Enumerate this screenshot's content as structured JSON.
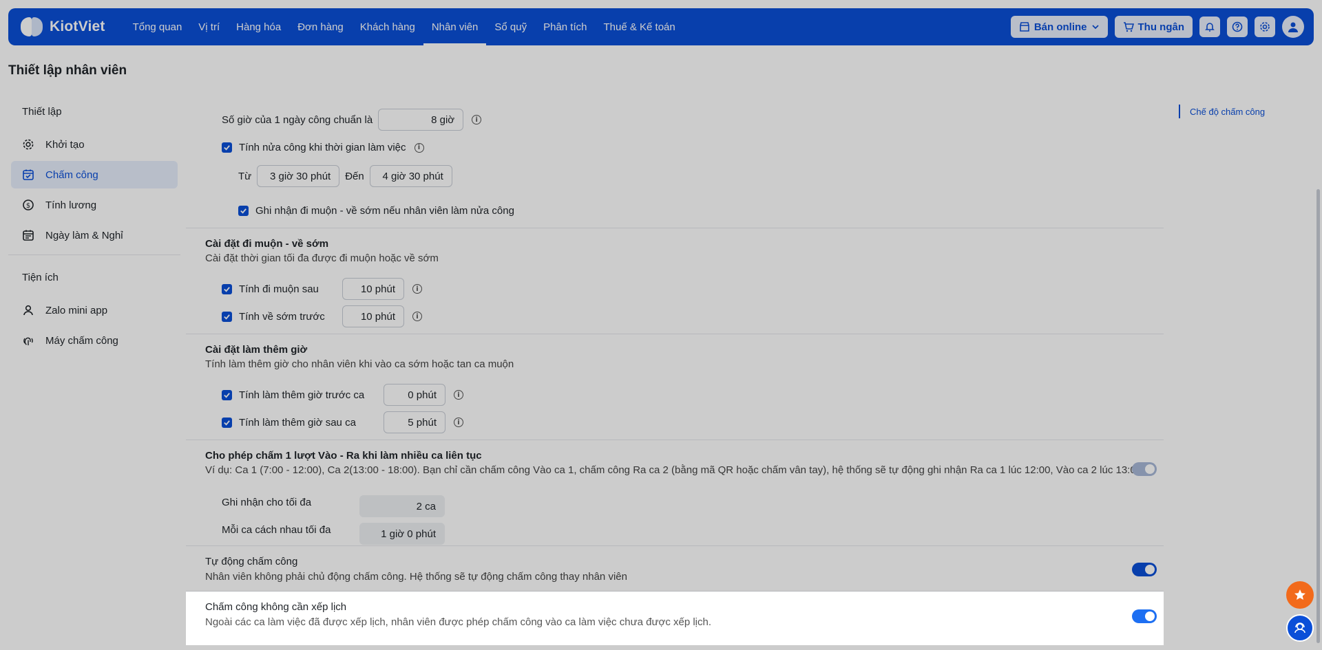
{
  "navbar": {
    "brand": "KiotViet",
    "items": [
      {
        "label": "Tổng quan"
      },
      {
        "label": "Vị trí"
      },
      {
        "label": "Hàng hóa"
      },
      {
        "label": "Đơn hàng"
      },
      {
        "label": "Khách hàng"
      },
      {
        "label": "Nhân viên",
        "active": true
      },
      {
        "label": "Sổ quỹ"
      },
      {
        "label": "Phân tích"
      },
      {
        "label": "Thuế & Kế toán"
      }
    ],
    "online_label": "Bán online",
    "cashier_label": "Thu ngân"
  },
  "page": {
    "title": "Thiết lập nhân viên"
  },
  "sidebar": {
    "group1": "Thiết lập",
    "items": [
      {
        "label": "Khởi tạo",
        "icon": "gear-icon"
      },
      {
        "label": "Chấm công",
        "icon": "calendar-check-icon",
        "active": true
      },
      {
        "label": "Tính lương",
        "icon": "dollar-circle-icon"
      },
      {
        "label": "Ngày làm & Nghỉ",
        "icon": "calendar-icon"
      }
    ],
    "group2": "Tiện ích",
    "items2": [
      {
        "label": "Zalo mini app",
        "icon": "user-icon"
      },
      {
        "label": "Máy chấm công",
        "icon": "fingerprint-icon"
      }
    ]
  },
  "standard_day": {
    "label": "Số giờ của 1 ngày công chuẩn là",
    "value": "8 giờ",
    "half_day_label": "Tính nửa công khi thời gian làm việc",
    "from_label": "Từ",
    "from_value": "3 giờ 30 phút",
    "to_label": "Đến",
    "to_value": "4 giờ 30 phút",
    "record_late_label": "Ghi nhận đi muộn - về sớm nếu nhân viên làm nửa công"
  },
  "late_early": {
    "title": "Cài đặt đi muộn - về sớm",
    "desc": "Cài đặt thời gian tối đa được đi muộn hoặc về sớm",
    "late_label": "Tính đi muộn sau",
    "late_value": "10 phút",
    "early_label": "Tính về sớm trước",
    "early_value": "10 phút"
  },
  "overtime": {
    "title": "Cài đặt làm thêm giờ",
    "desc": "Tính làm thêm giờ cho nhân viên khi vào ca sớm hoặc tan ca muộn",
    "before_label": "Tính làm thêm giờ trước ca",
    "before_value": "0 phút",
    "after_label": "Tính làm thêm giờ sau ca",
    "after_value": "5 phút"
  },
  "multi_shift": {
    "title": "Cho phép chấm 1 lượt Vào - Ra khi làm nhiều ca liên tục",
    "desc": "Ví dụ: Ca 1 (7:00 - 12:00), Ca 2(13:00 - 18:00). Bạn chỉ cần chấm công Vào ca 1, chấm công Ra ca 2 (bằng mã QR hoặc chấm vân tay), hệ thống sẽ tự động ghi nhận Ra ca 1 lúc 12:00, Vào ca 2 lúc 13:00",
    "max_label": "Ghi nhận cho tối đa",
    "max_value": "2 ca",
    "gap_label": "Mỗi ca cách nhau tối đa",
    "gap_value": "1 giờ 0 phút"
  },
  "auto_timekeeping": {
    "title": "Tự động chấm công",
    "desc": "Nhân viên không phải chủ động chấm công. Hệ thống sẽ tự động chấm công thay nhân viên"
  },
  "no_schedule": {
    "title": "Chấm công không cần xếp lịch",
    "desc": "Ngoài các ca làm việc đã được xếp lịch, nhân viên được phép chấm công vào ca làm việc chưa được xếp lịch."
  },
  "right_nav": {
    "item": "Chế độ chấm công"
  },
  "colors": {
    "brand": "#0b4fd8",
    "float_orange": "#f26a1b"
  }
}
